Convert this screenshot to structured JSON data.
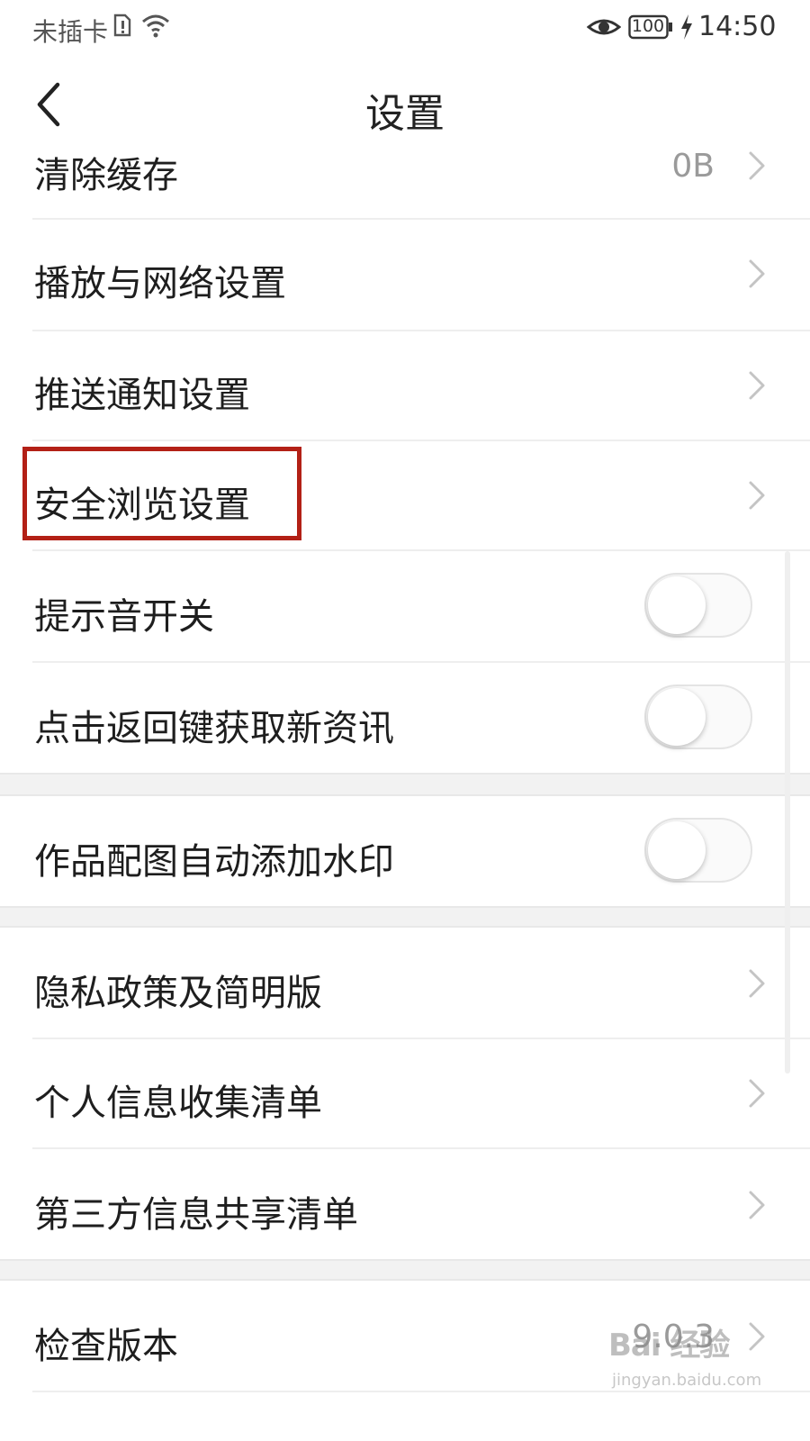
{
  "status_bar": {
    "carrier": "未插卡",
    "battery": "100",
    "time": "14:50",
    "icons": [
      "sim-alert-icon",
      "wifi-icon",
      "eye-icon",
      "battery-icon",
      "charging-icon"
    ]
  },
  "header": {
    "title": "设置",
    "back_icon": "chevron-left-icon"
  },
  "settings": {
    "clear_cache": {
      "label": "清除缓存",
      "value": "0B"
    },
    "playback_network": {
      "label": "播放与网络设置"
    },
    "push_notifications": {
      "label": "推送通知设置"
    },
    "safe_browsing": {
      "label": "安全浏览设置",
      "highlighted": true
    },
    "sound_toggle": {
      "label": "提示音开关",
      "on": false
    },
    "back_refresh": {
      "label": "点击返回键获取新资讯",
      "on": false
    },
    "watermark": {
      "label": "作品配图自动添加水印",
      "on": false
    },
    "privacy_policy": {
      "label": "隐私政策及简明版"
    },
    "personal_info": {
      "label": "个人信息收集清单"
    },
    "third_party": {
      "label": "第三方信息共享清单"
    },
    "check_version": {
      "label": "检查版本",
      "value": "9.0.3"
    }
  },
  "watermark_overlay": {
    "brand": "Bai 经验",
    "url": "jingyan.baidu.com"
  },
  "colors": {
    "highlight": "#b32016",
    "background": "#ffffff",
    "section_gap": "#f2f2f2"
  }
}
